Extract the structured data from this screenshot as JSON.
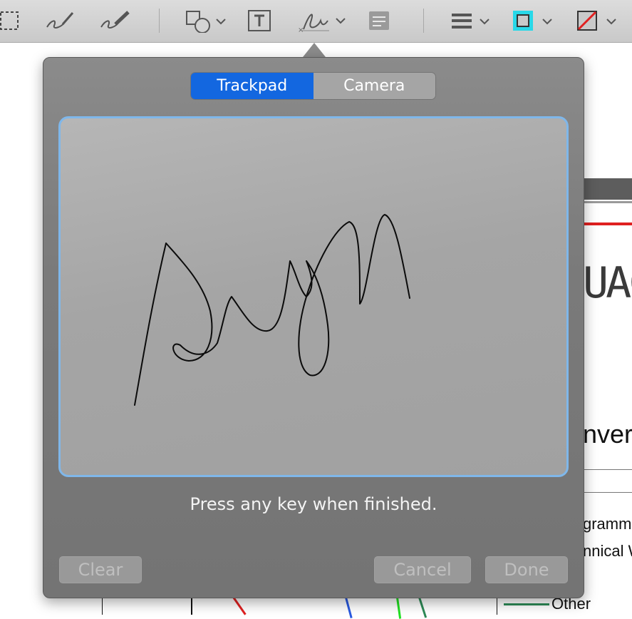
{
  "toolbar": {
    "tools": [
      {
        "icon": "selection-rect-icon"
      },
      {
        "icon": "sketch-icon"
      },
      {
        "icon": "draw-icon"
      },
      {
        "icon": "shapes-icon"
      },
      {
        "icon": "text-box-icon"
      },
      {
        "icon": "signature-icon"
      },
      {
        "icon": "note-icon"
      },
      {
        "icon": "line-style-icon"
      },
      {
        "icon": "border-color-icon",
        "color": "#28d8e8"
      },
      {
        "icon": "fill-color-icon",
        "color": "#e02020"
      }
    ]
  },
  "signature_popover": {
    "tabs": [
      {
        "label": "Trackpad",
        "active": true
      },
      {
        "label": "Camera",
        "active": false
      }
    ],
    "hint": "Press any key when finished.",
    "buttons": {
      "clear": "Clear",
      "cancel": "Cancel",
      "done": "Done"
    }
  },
  "background_document": {
    "large_text": "UAC",
    "heading": "nver",
    "lines": [
      "gramme",
      "nnical W"
    ],
    "legend_other": "Other"
  },
  "colors": {
    "accent": "#1367e0",
    "pad_border": "#7fb7ea"
  }
}
